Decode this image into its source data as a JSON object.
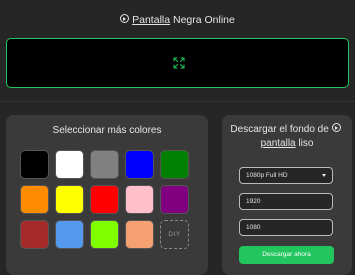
{
  "header": {
    "title_link": "Pantalla",
    "title_rest": " Negra Online"
  },
  "preview": {
    "color": "#000000",
    "border_color": "#22c55e",
    "icon": "expand-icon"
  },
  "colors_panel": {
    "title": "Seleccionar más colores",
    "swatches": [
      {
        "color": "#000000"
      },
      {
        "color": "#ffffff"
      },
      {
        "color": "#808080"
      },
      {
        "color": "#0000ff"
      },
      {
        "color": "#008000"
      },
      {
        "color": "#ff8c00"
      },
      {
        "color": "#ffff00"
      },
      {
        "color": "#ff0000"
      },
      {
        "color": "#ffc0cb"
      },
      {
        "color": "#800080"
      },
      {
        "color": "#a52a2a"
      },
      {
        "color": "#5599ee"
      },
      {
        "color": "#7fff00"
      },
      {
        "color": "#f4a070"
      }
    ],
    "diy_label": "DIY"
  },
  "download_panel": {
    "title_prefix": "Descargar el fondo de",
    "title_link": "pantalla",
    "title_suffix": " liso",
    "resolution_value": "1080p Full HD",
    "width_value": "1920",
    "height_value": "1080",
    "button_label": "Descargar ahora",
    "accent": "#22c55e"
  }
}
